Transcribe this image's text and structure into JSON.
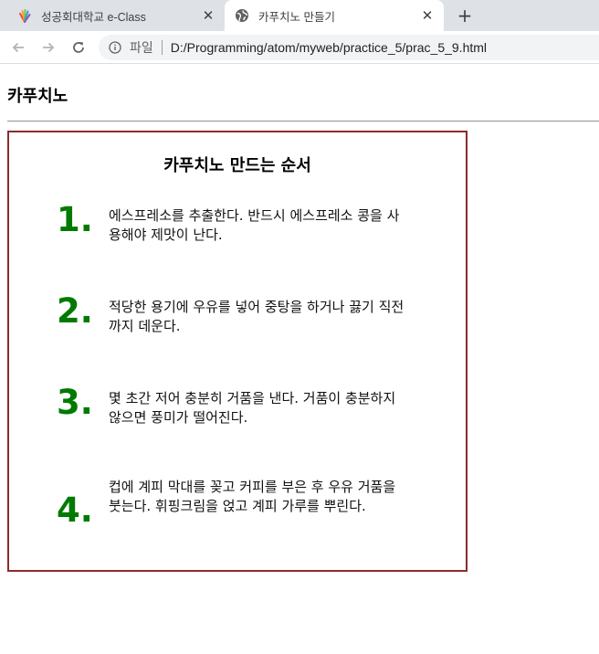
{
  "browser": {
    "tabs": [
      {
        "title": "성공회대학교 e-Class",
        "favicon": "colorful-hand-icon",
        "active": false
      },
      {
        "title": "카푸치노 만들기",
        "favicon": "globe-icon",
        "active": true
      }
    ],
    "close_glyph": "✕",
    "newtab_glyph": "+",
    "address": {
      "scheme_label": "파일",
      "url": "D:/Programming/atom/myweb/practice_5/prac_5_9.html"
    }
  },
  "page": {
    "heading": "카푸치노",
    "recipe": {
      "title": "카푸치노 만드는 순서",
      "steps": [
        {
          "number": "1.",
          "text": "에스프레소를 추출한다. 반드시 에스프레소 콩을 사용해야 제맛이 난다."
        },
        {
          "number": "2.",
          "text": "적당한 용기에 우유를 넣어 중탕을 하거나 끓기 직전까지 데운다."
        },
        {
          "number": "3.",
          "text": "몇 초간 저어 충분히 거품을 낸다. 거품이 충분하지 않으면 풍미가 떨어진다."
        },
        {
          "number": "4.",
          "text": "컵에 계피 막대를 꽂고 커피를 부은 후 우유 거품을 붓는다. 휘핑크림을 얹고 계피 가루를 뿌린다."
        }
      ]
    }
  },
  "colors": {
    "tabstrip_bg": "#dee1e6",
    "step_number": "#007a00",
    "box_border": "#8b2c2c"
  }
}
